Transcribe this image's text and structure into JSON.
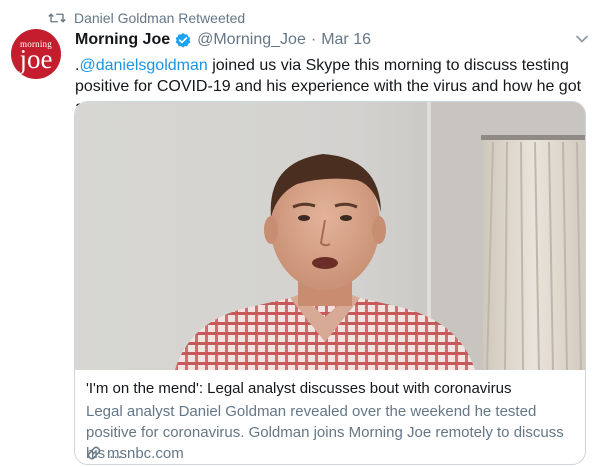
{
  "retweet": {
    "icon": "retweet-icon",
    "label": "Daniel Goldman Retweeted"
  },
  "tweet": {
    "avatar": {
      "line1": "morning",
      "line2": "joe",
      "color": "#c41e2e"
    },
    "display_name": "Morning Joe",
    "verified_icon": "verified-badge-icon",
    "handle": "@Morning_Joe",
    "separator": "·",
    "date": "Mar 16",
    "menu_icon": "chevron-down-icon",
    "text": {
      "lead": ".",
      "mention": "@danielsgoldman",
      "rest": " joined us via Skype this morning to discuss testing positive for COVID-19 and his experience with the virus and how he got a test:"
    }
  },
  "card": {
    "image_icon": "video-still-man-in-red-plaid-shirt",
    "title": "'I'm on the mend': Legal analyst discusses bout with coronavirus",
    "description": "Legal analyst Daniel Goldman revealed over the weekend he tested positive for coronavirus. Goldman joins Morning Joe remotely to discuss his ...",
    "domain_icon": "link-icon",
    "domain": "msnbc.com"
  },
  "colors": {
    "accent": "#1b95e0",
    "secondary_text": "#657786",
    "primary_text": "#14171a",
    "border": "#ccd6dd"
  }
}
